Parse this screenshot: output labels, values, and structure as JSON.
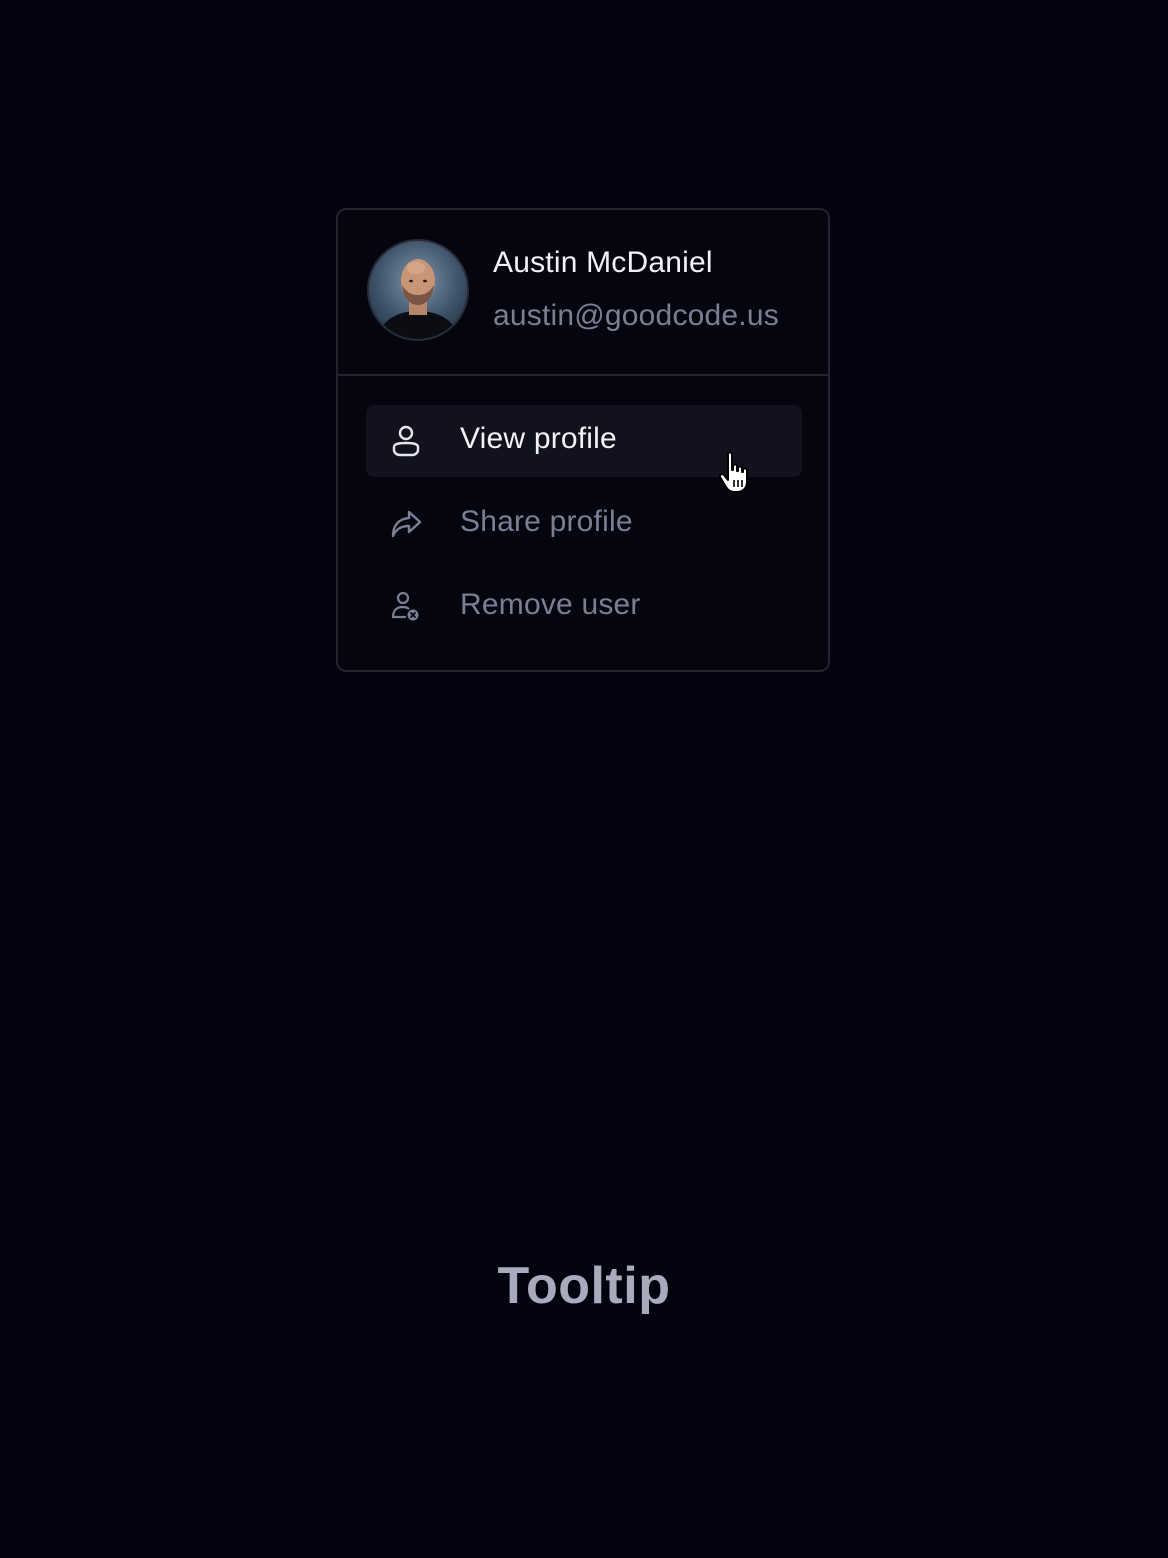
{
  "user": {
    "name": "Austin McDaniel",
    "email": "austin@goodcode.us",
    "avatar_icon": "user-photo"
  },
  "menu": {
    "items": [
      {
        "label": "View profile",
        "icon": "user-icon",
        "active": true
      },
      {
        "label": "Share profile",
        "icon": "share-arrow-icon",
        "active": false
      },
      {
        "label": "Remove user",
        "icon": "remove-user-icon",
        "active": false
      }
    ]
  },
  "caption": "Tooltip",
  "colors": {
    "background": "#03030f",
    "card_border": "#23242f",
    "active_item_bg": "#11121d",
    "text_primary": "#f2f3f7",
    "text_muted": "#7c7f94",
    "caption": "#a9abbd"
  }
}
